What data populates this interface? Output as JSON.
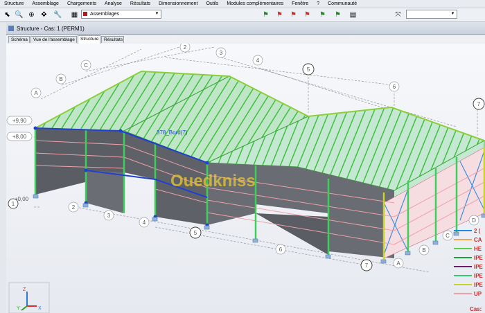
{
  "menu": [
    "Structure",
    "Assemblage",
    "Chargements",
    "Analyse",
    "Résultats",
    "Dimensionnement",
    "Outils",
    "Modules complémentaires",
    "Fenêtre",
    "?",
    "Communauté"
  ],
  "toolbar": {
    "combo_value": "Assemblages"
  },
  "window": {
    "title": "Structure - Cas: 1 (PERM1)"
  },
  "tabs": [
    "Schéma",
    "Vue de l'assemblage",
    "Structure",
    "Résultats"
  ],
  "view": {
    "elevations": [
      "+9,90",
      "+8,00",
      "+0,00"
    ],
    "grid_numbers": [
      "1",
      "2",
      "3",
      "4",
      "5",
      "6",
      "7"
    ],
    "grid_letters": [
      "A",
      "B",
      "C",
      "D"
    ],
    "bar_label": "378_Bord(7)",
    "watermark": "Ouedkniss",
    "axes": [
      "Z",
      "Y",
      "X"
    ]
  },
  "legend": {
    "items": [
      {
        "text": "2 (",
        "color": "#1e88e5"
      },
      {
        "text": "CA",
        "color": "#f2a44a"
      },
      {
        "text": "HE",
        "color": "#5ad04a"
      },
      {
        "text": "IPE",
        "color": "#1aa33a"
      },
      {
        "text": "IPE",
        "color": "#6a1b6a"
      },
      {
        "text": "IPE",
        "color": "#2ecc71"
      },
      {
        "text": "IPE",
        "color": "#c8d42a"
      },
      {
        "text": "UP",
        "color": "#f0a0a8"
      }
    ],
    "cas": "Cas:"
  }
}
